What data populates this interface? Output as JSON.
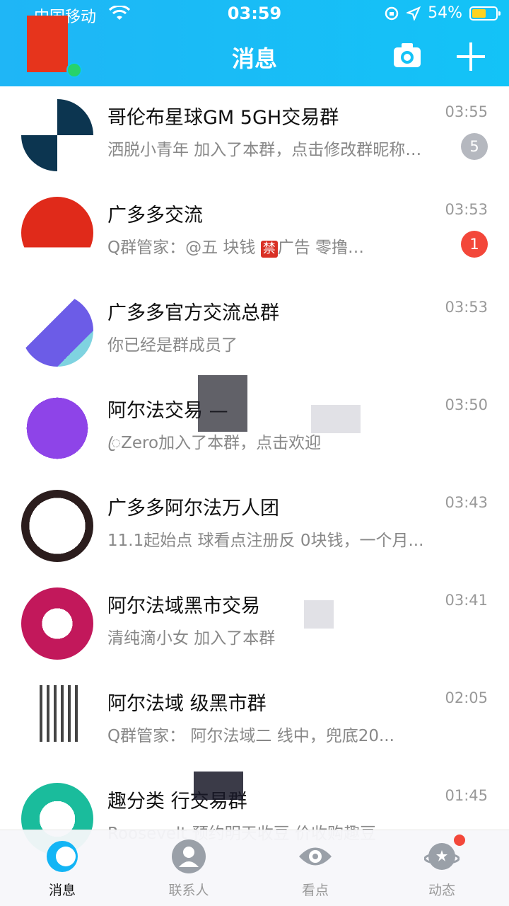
{
  "status_bar": {
    "carrier": "中国移动",
    "time": "03:59",
    "battery": "54%",
    "battery_level": 0.54
  },
  "header": {
    "title": "消息"
  },
  "conversations": [
    {
      "title": "哥伦布星球GM 5GH交易群",
      "preview": "洒脱小青年 加入了本群，点击修改群昵称…",
      "time": "03:55",
      "badge": "5",
      "badge_style": "gray"
    },
    {
      "title": "广多多交流",
      "preview_before": "Q群管家：@五 块钱 ",
      "preview_ban": "禁",
      "preview_after": "广告 零撸…",
      "time": "03:53",
      "badge": "1",
      "badge_style": "red"
    },
    {
      "title": "广多多官方交流总群",
      "preview": "你已经是群成员了",
      "time": "03:53"
    },
    {
      "title": "阿尔法交易 —",
      "preview": "ꦿZero加入了本群，点击欢迎",
      "time": "03:50"
    },
    {
      "title": "广多多阿尔法万人团",
      "preview": "11.1起始点 球看点注册反 0块钱，一个月...",
      "time": "03:43"
    },
    {
      "title": "阿尔法域黑市交易",
      "preview": "清纯滴小女 加入了本群",
      "time": "03:41"
    },
    {
      "title": "阿尔法域 级黑市群",
      "preview": "Q群管家： 阿尔法域二 线中，兜底20...",
      "time": "02:05"
    },
    {
      "title": "趣分类 行交易群",
      "preview": "Roosevelt 预约明天收豆 价收购趣豆",
      "time": "01:45"
    }
  ],
  "tabbar": {
    "tabs": [
      {
        "label": "消息",
        "icon": "message-icon"
      },
      {
        "label": "联系人",
        "icon": "contacts-icon"
      },
      {
        "label": "看点",
        "icon": "eye-icon"
      },
      {
        "label": "动态",
        "icon": "planet-icon"
      }
    ]
  },
  "colors": {
    "header": "#13c3f7",
    "badge_red": "#f3473a",
    "badge_gray": "#b5b8bf",
    "online": "#27d26b"
  }
}
